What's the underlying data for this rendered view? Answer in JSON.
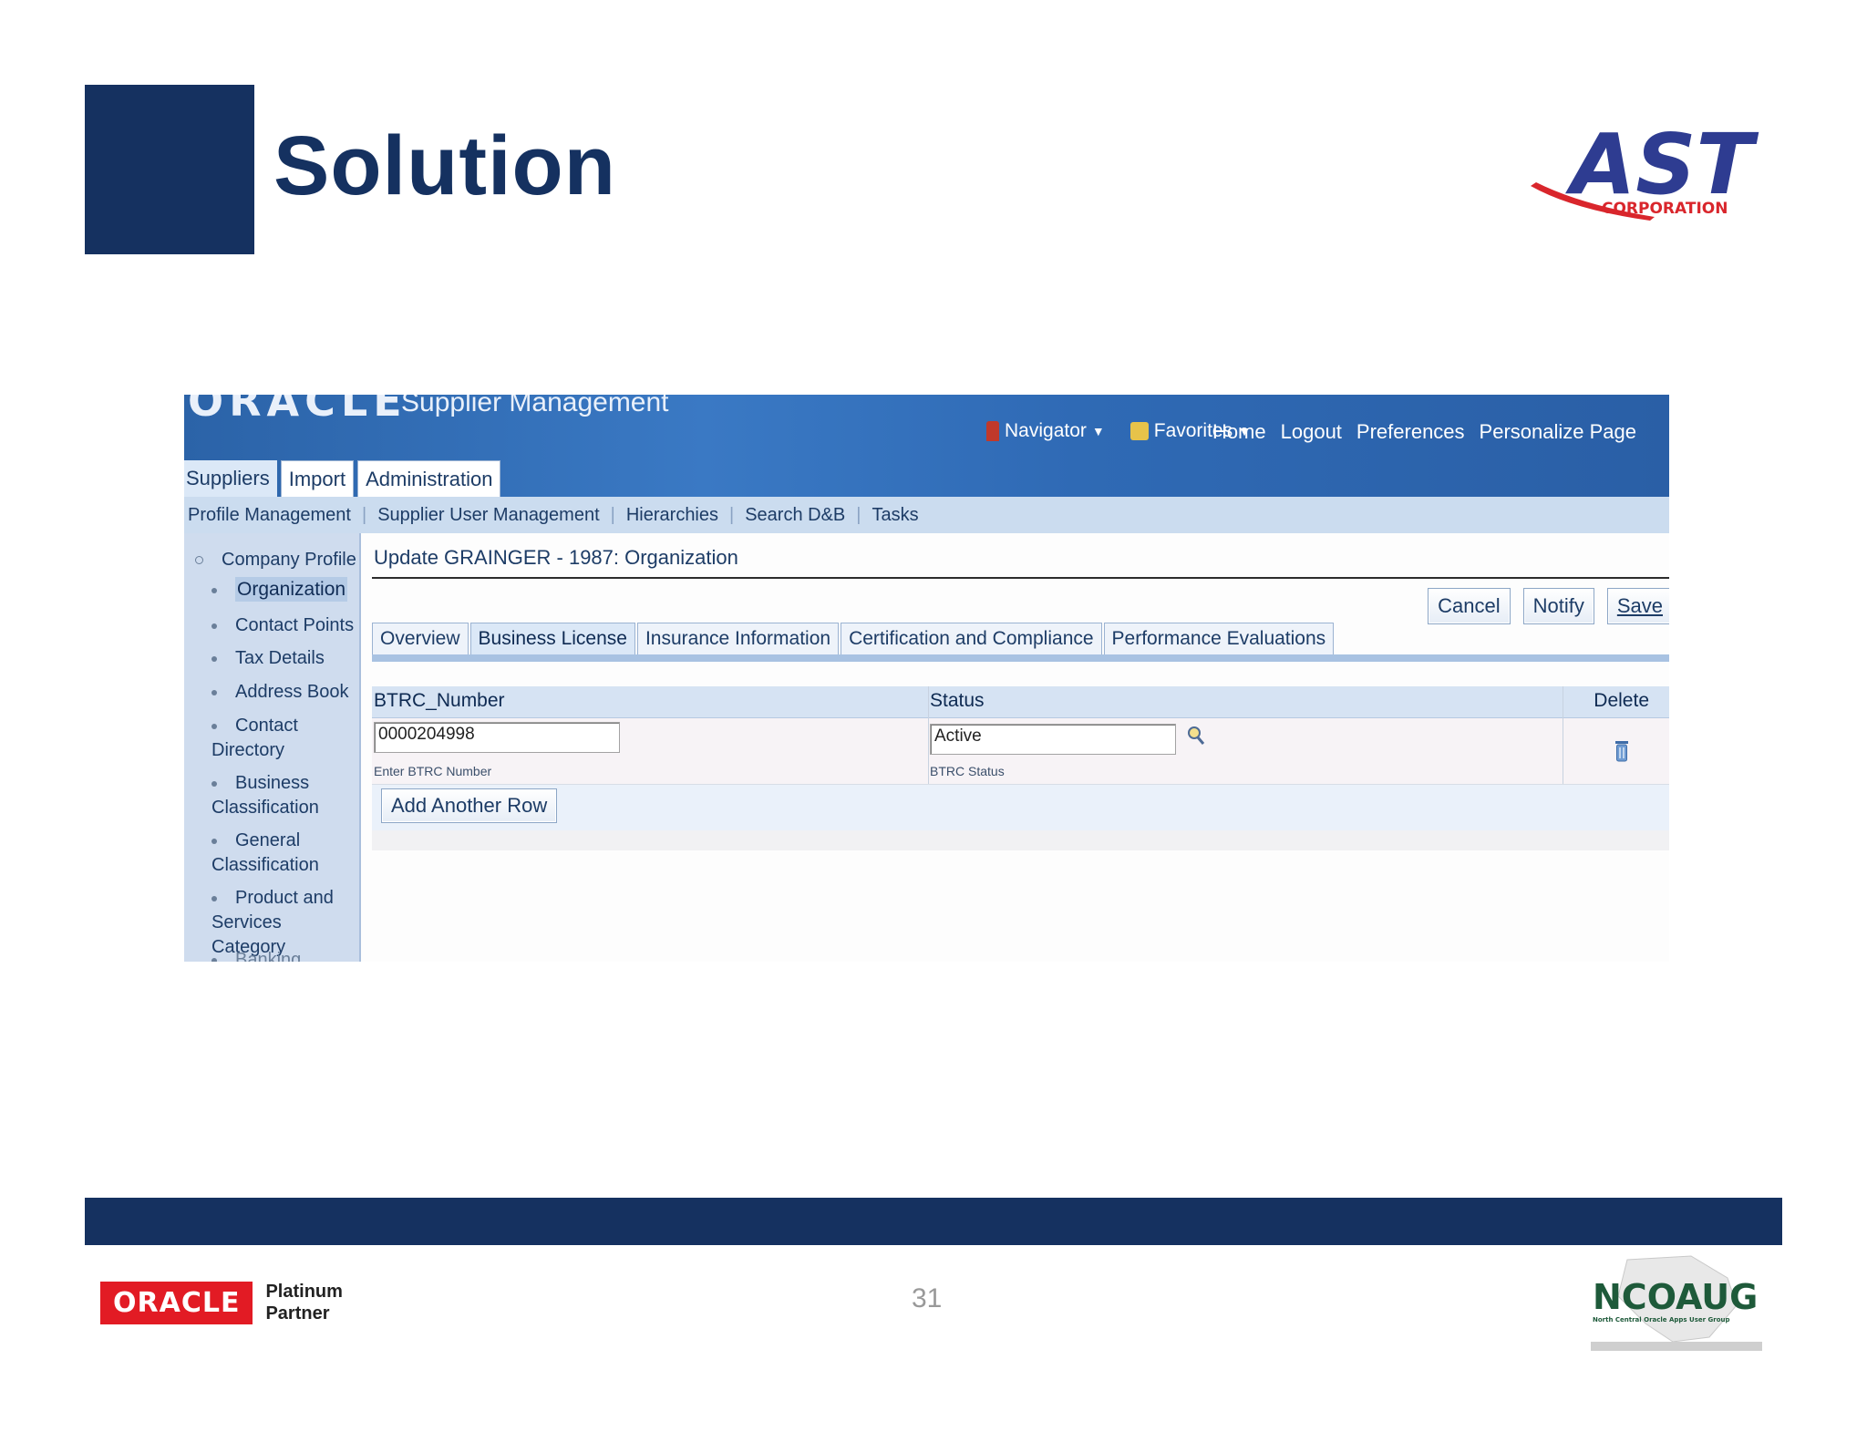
{
  "slide": {
    "title": "Solution",
    "page_number": "31",
    "logos": {
      "ast": {
        "main": "AST",
        "sub": "CORPORATION"
      },
      "oracle_partner": {
        "oracle": "ORACLE",
        "line1": "Platinum",
        "line2": "Partner"
      },
      "ncoaug": {
        "main": "NCOAUG",
        "sub": "North Central Oracle Apps User Group"
      }
    }
  },
  "app": {
    "brand": "ORACLE",
    "module": "Supplier Management",
    "global_links": [
      "Home",
      "Logout",
      "Preferences",
      "Personalize Page"
    ],
    "navigator": "Navigator",
    "favorites": "Favorites",
    "top_tabs": [
      "Suppliers",
      "Import",
      "Administration"
    ],
    "subnav": [
      "Profile Management",
      "Supplier User Management",
      "Hierarchies",
      "Search D&B",
      "Tasks"
    ],
    "sidenav": {
      "company_profile": "Company Profile",
      "items": [
        "Organization",
        "Contact Points",
        "Tax Details",
        "Address Book",
        "Contact Directory",
        "Business Classification",
        "General Classification",
        "Product and Services Category"
      ],
      "partial": "Banking Details"
    },
    "page_title": "Update GRAINGER - 1987: Organization",
    "actions": [
      "Cancel",
      "Notify",
      "Save"
    ],
    "subtabs": [
      "Overview",
      "Business License",
      "Insurance Information",
      "Certification and Compliance",
      "Performance Evaluations"
    ],
    "active_subtab": "Business License",
    "grid": {
      "headers": {
        "btrc": "BTRC_Number",
        "status": "Status",
        "delete": "Delete"
      },
      "row": {
        "btrc_value": "0000204998",
        "btrc_hint": "Enter BTRC Number",
        "status_value": "Active",
        "status_hint": "BTRC Status"
      },
      "add_row": "Add Another Row"
    }
  },
  "colors": {
    "navy": "#153160",
    "oracle_red": "#e21b24",
    "header_blue": "#2f6ab5"
  }
}
